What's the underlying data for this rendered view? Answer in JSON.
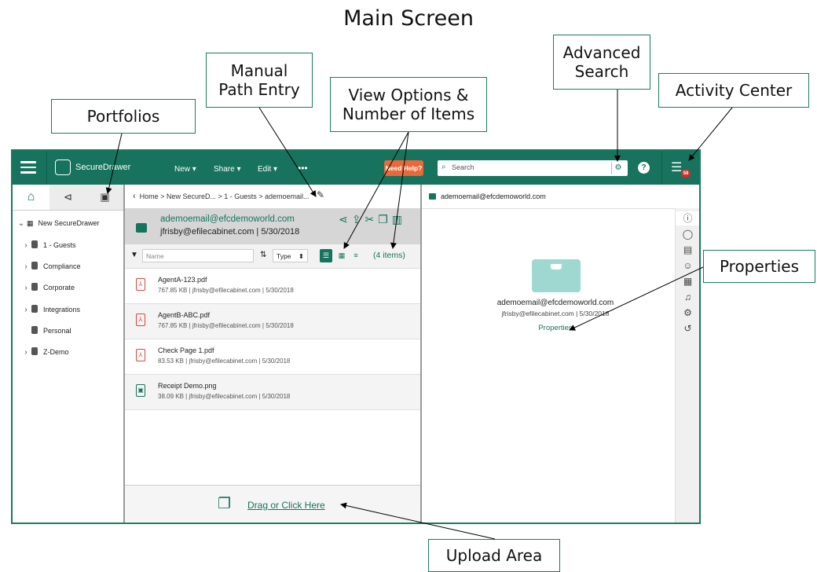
{
  "page_title": "Main Screen",
  "callouts": {
    "portfolios": "Portfolios",
    "manual_path_entry": "Manual Path Entry",
    "view_options": "View Options & Number of Items",
    "advanced_search": "Advanced Search",
    "activity_center": "Activity Center",
    "properties": "Properties",
    "upload_area": "Upload Area"
  },
  "app": {
    "logo": "SecureDrawer",
    "menus": [
      "New ▾",
      "Share ▾",
      "Edit ▾",
      "•••"
    ],
    "need_help": "Need Help?",
    "search_placeholder": "Search",
    "activity_badge": "58"
  },
  "tree": {
    "root": "New SecureDrawer",
    "items": [
      "1 - Guests",
      "Compliance",
      "Corporate",
      "Integrations",
      "Personal",
      "Z-Demo"
    ]
  },
  "breadcrumb": "Home > New SecureD... > 1 - Guests > ademoemail...",
  "folder": {
    "email": "ademoemail@efcdemoworld.com",
    "sub": "jfrisby@efilecabinet.com | 5/30/2018"
  },
  "filter": {
    "name_placeholder": "Name",
    "type_label": "Type",
    "count": "(4 items)"
  },
  "files": [
    {
      "name": "AgentA-123.pdf",
      "meta": "767.85 KB | jfrisby@efilecabinet.com | 5/30/2018"
    },
    {
      "name": "AgentB-ABC.pdf",
      "meta": "767.85 KB | jfrisby@efilecabinet.com | 5/30/2018"
    },
    {
      "name": "Check Page 1.pdf",
      "meta": "83.53 KB | jfrisby@efilecabinet.com | 5/30/2018"
    },
    {
      "name": "Receipt Demo.png",
      "meta": "38.09 KB | jfrisby@efilecabinet.com | 5/30/2018"
    }
  ],
  "upload_label": "Drag or Click Here",
  "right": {
    "header": "ademoemail@efcdemoworld.com",
    "email": "ademoemail@efcdemoworld.com",
    "sub": "jfrisby@efilecabinet.com | 5/30/2018",
    "properties_link": "Properties"
  }
}
